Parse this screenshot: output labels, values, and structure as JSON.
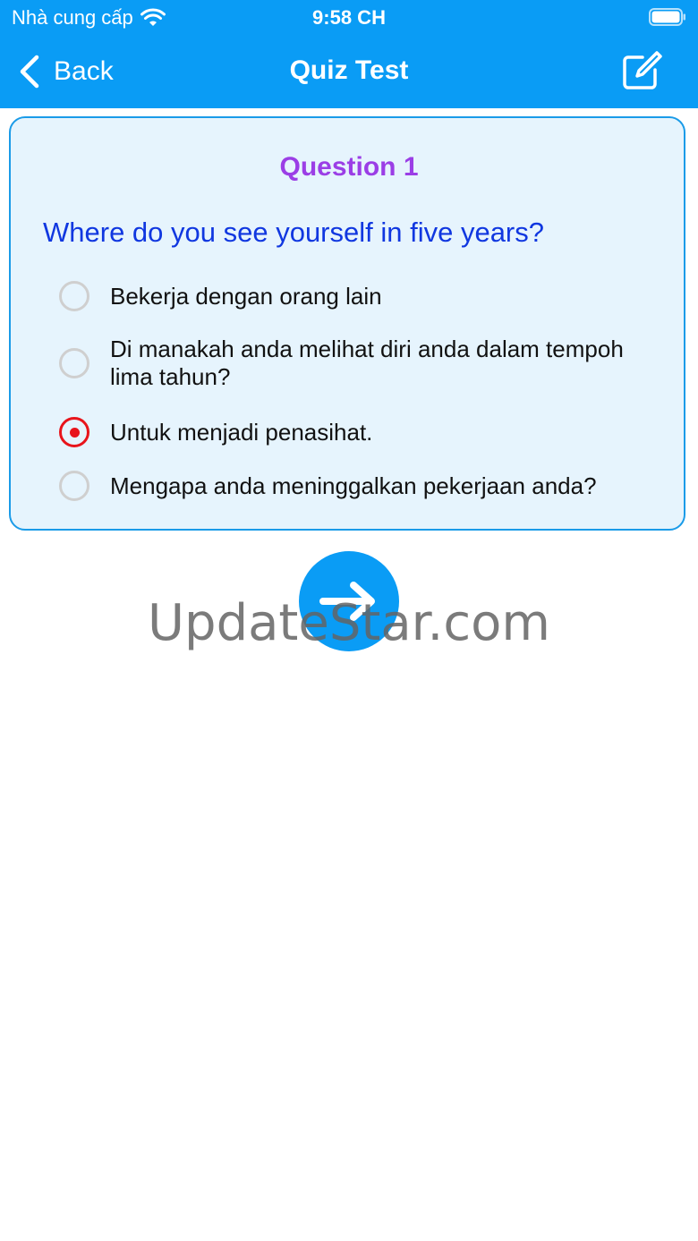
{
  "status_bar": {
    "carrier": "Nhà cung cấp",
    "time": "9:58 CH",
    "wifi_icon": "wifi-icon",
    "battery_icon": "battery-icon"
  },
  "nav": {
    "back_label": "Back",
    "title": "Quiz Test",
    "back_icon": "chevron-left-icon",
    "edit_icon": "edit-icon"
  },
  "quiz": {
    "question_number": "Question 1",
    "question_text": "Where do you see yourself in five years?",
    "options": [
      {
        "label": "Bekerja dengan orang lain",
        "selected": false
      },
      {
        "label": "Di manakah anda melihat diri anda dalam tempoh lima tahun?",
        "selected": false
      },
      {
        "label": "Untuk menjadi penasihat.",
        "selected": true
      },
      {
        "label": "Mengapa anda meninggalkan pekerjaan anda?",
        "selected": false
      }
    ],
    "next_icon": "arrow-right-icon"
  },
  "watermark": "UpdateStar.com",
  "colors": {
    "primary": "#0A9CF5",
    "card_bg": "#E6F4FD",
    "question_number": "#9B3EE6",
    "question_text": "#1037E0",
    "selected_radio": "#E8141B"
  }
}
